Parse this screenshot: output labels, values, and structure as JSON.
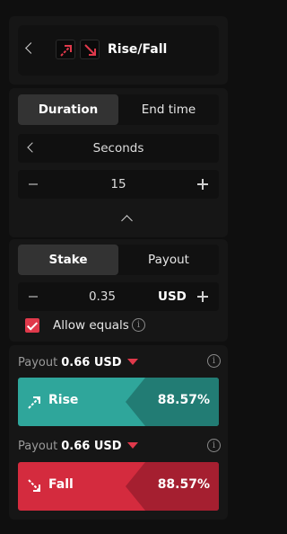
{
  "trade_type": {
    "label": "Rise/Fall",
    "icons": [
      "rise-arrow-icon",
      "fall-arrow-icon"
    ]
  },
  "duration": {
    "tabs": [
      "Duration",
      "End time"
    ],
    "active_tab": "Duration",
    "unit": "Seconds",
    "value": "15"
  },
  "stake": {
    "tabs": [
      "Stake",
      "Payout"
    ],
    "active_tab": "Stake",
    "amount": "0.35",
    "currency": "USD",
    "allow_equals_label": "Allow equals",
    "allow_equals_checked": true
  },
  "purchase": {
    "payout_label": "Payout",
    "rise": {
      "payout": "0.66 USD",
      "label": "Rise",
      "percentage": "88.57%"
    },
    "fall": {
      "payout": "0.66 USD",
      "label": "Fall",
      "percentage": "88.57%"
    }
  },
  "colors": {
    "rise": "#2fa69b",
    "fall": "#d42b3e",
    "accent": "#e0394b"
  }
}
